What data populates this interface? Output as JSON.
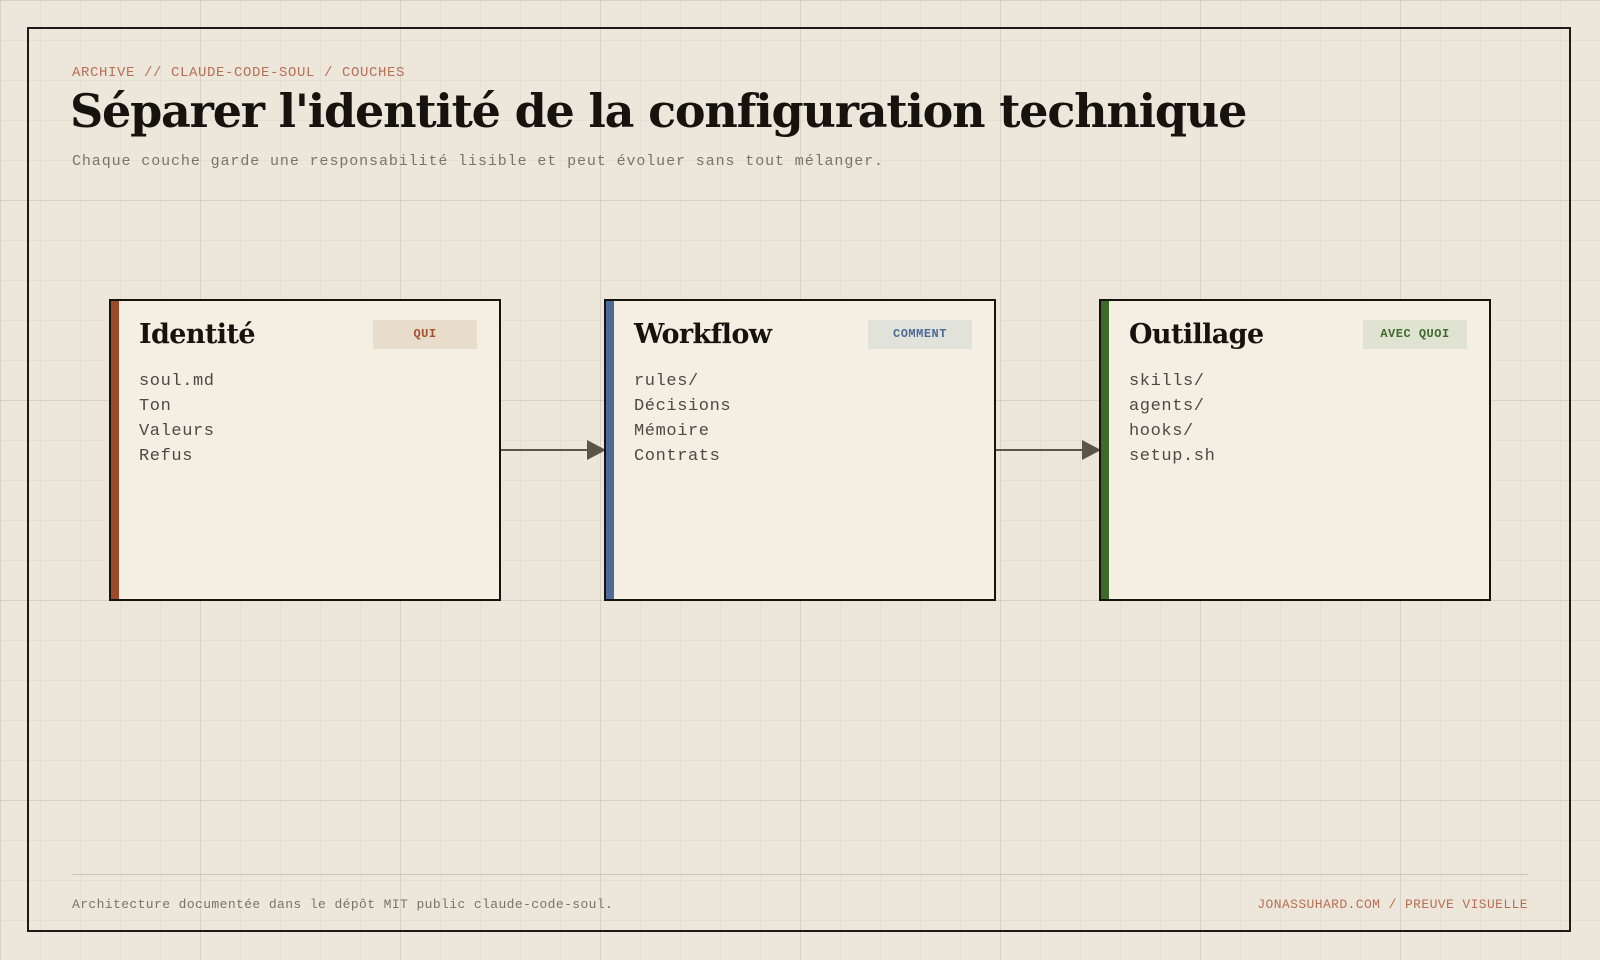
{
  "header": {
    "breadcrumb": "ARCHIVE // CLAUDE-CODE-SOUL / COUCHES",
    "title": "Séparer l'identité de la configuration technique",
    "subtitle": "Chaque couche garde une responsabilité lisible et peut évoluer sans tout mélanger."
  },
  "cards": [
    {
      "title": "Identité",
      "badge": "QUI",
      "items": [
        "soul.md",
        "Ton",
        "Valeurs",
        "Refus"
      ],
      "accent": "#9c4a2a",
      "badge_bg": "#e8dccb",
      "badge_color": "#a3522f"
    },
    {
      "title": "Workflow",
      "badge": "COMMENT",
      "items": [
        "rules/",
        "Décisions",
        "Mémoire",
        "Contrats"
      ],
      "accent": "#4e6a96",
      "badge_bg": "#e1e2da",
      "badge_color": "#4e6a96"
    },
    {
      "title": "Outillage",
      "badge": "AVEC QUOI",
      "items": [
        "skills/",
        "agents/",
        "hooks/",
        "setup.sh"
      ],
      "accent": "#3f6a2c",
      "badge_bg": "#e0e3d1",
      "badge_color": "#3f6a2c"
    }
  ],
  "connectors": [
    {
      "from": "Identité",
      "to": "Workflow"
    },
    {
      "from": "Workflow",
      "to": "Outillage"
    }
  ],
  "footer": {
    "left": "Architecture documentée dans le dépôt MIT public claude-code-soul.",
    "right": "JONASSUHARD.COM / PREUVE VISUELLE"
  },
  "colors": {
    "ink": "#16130f",
    "paper": "#ece7da",
    "card_bg": "#f4efe2",
    "connector": "#5a5548",
    "rust": "#b86f55"
  }
}
